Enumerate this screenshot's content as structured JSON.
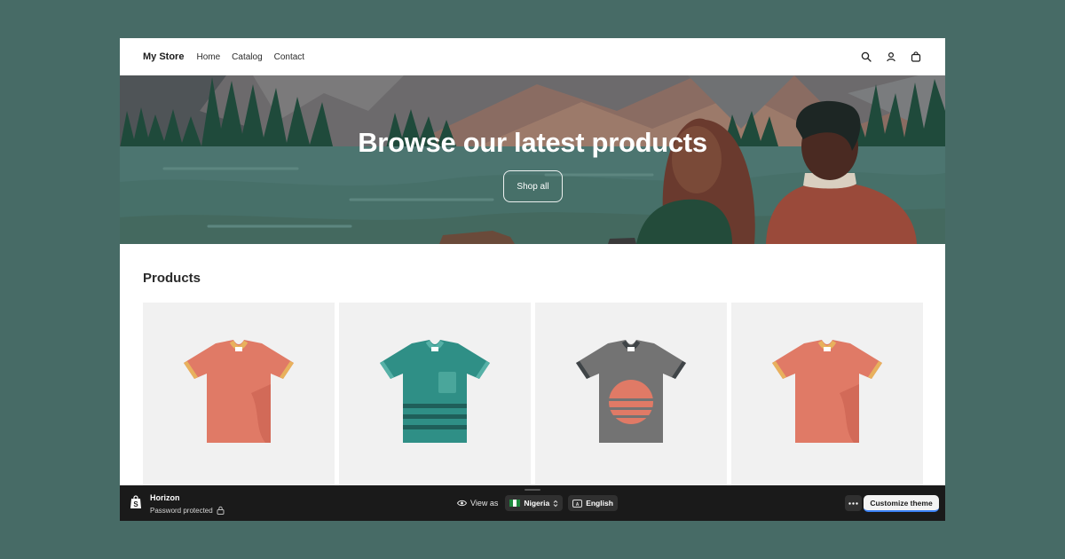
{
  "header": {
    "brand": "My Store",
    "nav": [
      "Home",
      "Catalog",
      "Contact"
    ],
    "icons": [
      "search-icon",
      "account-icon",
      "cart-icon"
    ]
  },
  "hero": {
    "title": "Browse our latest products",
    "button": "Shop all"
  },
  "products": {
    "heading": "Products",
    "items": [
      {
        "shirt_color": "#e07a66",
        "trim_color": "#e8b15d"
      },
      {
        "shirt_color": "#2f8f86",
        "trim_color": "#56b1a7"
      },
      {
        "shirt_color": "#737373",
        "trim_color": "#3f4447"
      },
      {
        "shirt_color": "#e07a66",
        "trim_color": "#e8b15d"
      }
    ]
  },
  "admin_bar": {
    "theme_name": "Horizon",
    "status": "Password protected",
    "view_as": "View as",
    "country": "Nigeria",
    "language": "English",
    "customize": "Customize theme"
  },
  "colors": {
    "background": "#476b66",
    "admin_bar": "#1a1a1a",
    "accent": "#3b82f6"
  }
}
